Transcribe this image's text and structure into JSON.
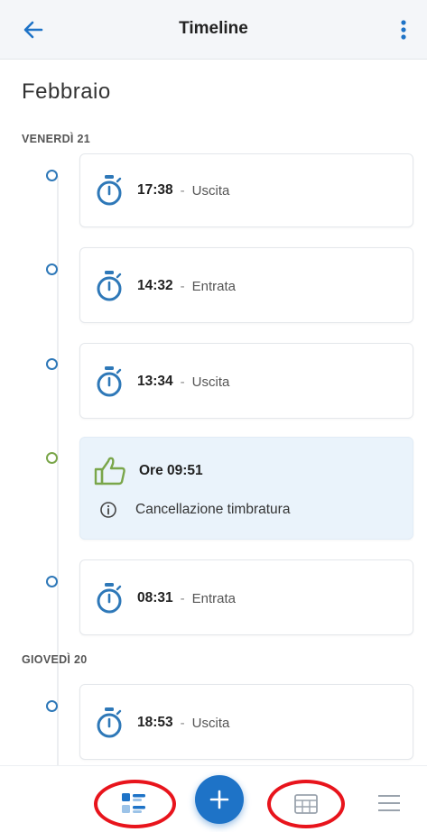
{
  "header": {
    "title": "Timeline"
  },
  "month": "Febbraio",
  "days": [
    {
      "label": "VENERDÌ 21",
      "entries": [
        {
          "type": "stamp",
          "time": "17:38",
          "separator": "-",
          "kind": "Uscita"
        },
        {
          "type": "stamp",
          "time": "14:32",
          "separator": "-",
          "kind": "Entrata"
        },
        {
          "type": "stamp",
          "time": "13:34",
          "separator": "-",
          "kind": "Uscita"
        },
        {
          "type": "approval",
          "hours": "Ore 09:51",
          "note": "Cancellazione timbratura"
        },
        {
          "type": "stamp",
          "time": "08:31",
          "separator": "-",
          "kind": "Entrata"
        }
      ]
    },
    {
      "label": "GIOVEDÌ 20",
      "entries": [
        {
          "type": "stamp",
          "time": "18:53",
          "separator": "-",
          "kind": "Uscita"
        }
      ]
    }
  ],
  "colors": {
    "accent": "#1e73c7",
    "stopwatch": "#2e78b8",
    "approval_green": "#7aa64a",
    "highlight_card": "#eaf3fb",
    "annotation_red": "#e8141c"
  },
  "bottom_nav": {
    "items": [
      "dashboard-icon",
      "add-icon",
      "calendar-icon",
      "menu-icon"
    ]
  }
}
